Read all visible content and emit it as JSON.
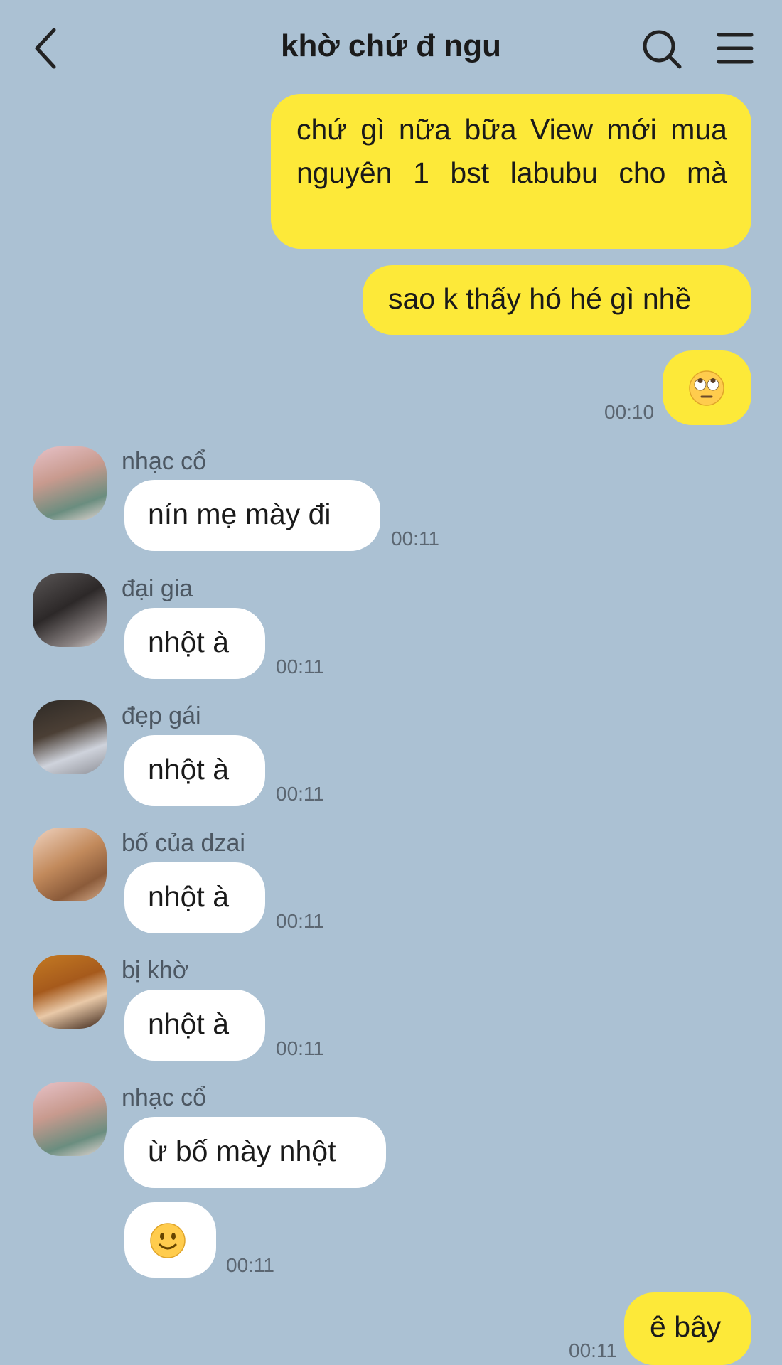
{
  "header": {
    "title": "khờ chứ đ ngu"
  },
  "messages": [
    {
      "text": "chứ gì nữa bữa View mới mua nguyên 1 bst labubu cho mà"
    },
    {
      "text": "sao k thấy hó hé gì nhề"
    },
    {
      "emoji": "face-with-rolling-eyes",
      "time": "00:10"
    },
    {
      "sender": "nhạc cổ",
      "text": "nín mẹ mày đi",
      "time": "00:11"
    },
    {
      "sender": "đại gia",
      "text": "nhột à",
      "time": "00:11"
    },
    {
      "sender": "đẹp gái",
      "text": "nhột à",
      "time": "00:11"
    },
    {
      "sender": "bố của dzai",
      "text": "nhột à",
      "time": "00:11"
    },
    {
      "sender": "bị khờ",
      "text": "nhột à",
      "time": "00:11"
    },
    {
      "sender": "nhạc cổ",
      "text": "ừ bố mày nhột"
    },
    {
      "emoji": "slightly-smiling-face",
      "time": "00:11"
    },
    {
      "text": "ê bây",
      "time": "00:11"
    }
  ],
  "colors": {
    "background": "#abc1d3",
    "outgoing": "#fde939",
    "incoming": "#ffffff"
  }
}
